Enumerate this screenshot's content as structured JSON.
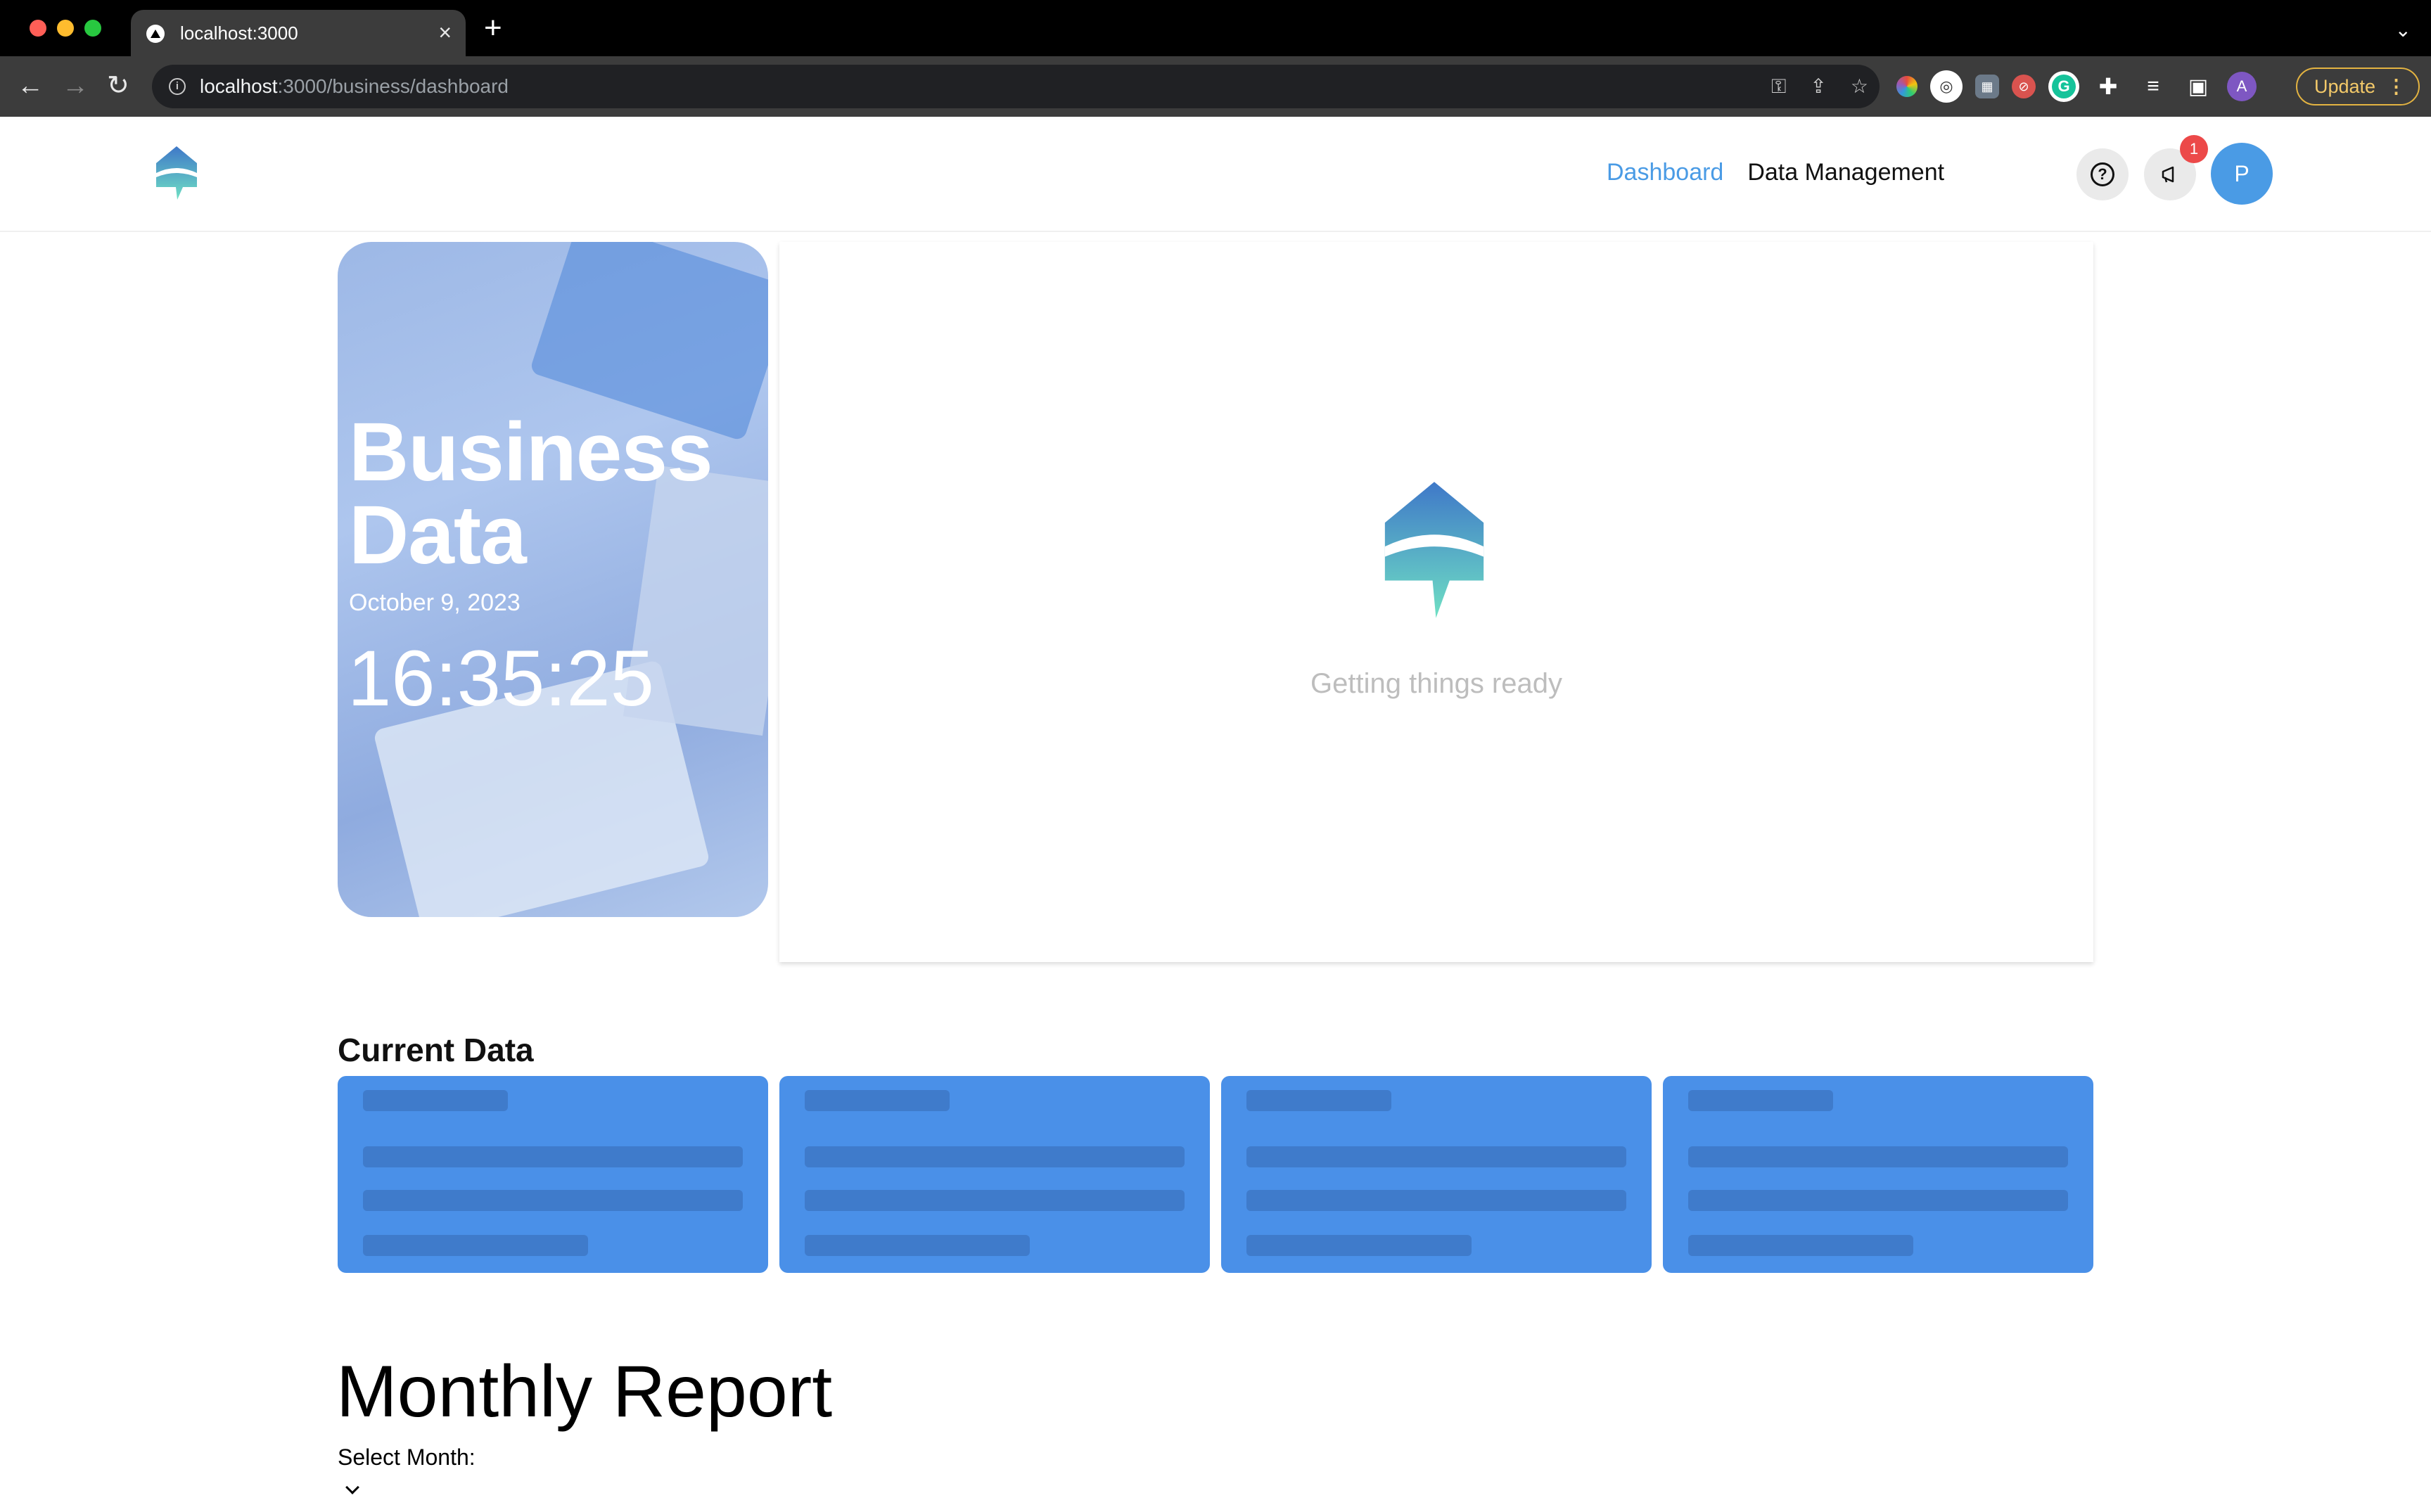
{
  "browser": {
    "tab_title": "localhost:3000",
    "url_host": "localhost",
    "url_path": ":3000/business/dashboard",
    "update_label": "Update",
    "colors": {
      "frame": "#000000",
      "toolbar": "#3c3c3c",
      "update_border": "#e3b341"
    }
  },
  "header": {
    "nav": [
      {
        "label": "Dashboard",
        "active": true
      },
      {
        "label": "Data Management",
        "active": false
      }
    ],
    "notification_count": "1",
    "avatar_initial": "P",
    "colors": {
      "accent": "#4a9be5",
      "badge": "#ec4949"
    }
  },
  "hero": {
    "title_line1": "Business",
    "title_line2": "Data",
    "date": "October 9, 2023",
    "time": "16:35:25"
  },
  "loading": {
    "message": "Getting things ready"
  },
  "current_data": {
    "title": "Current Data",
    "card_color": "#4a90e8",
    "cards": [
      "loading",
      "loading",
      "loading",
      "loading"
    ]
  },
  "report": {
    "title": "Monthly Report",
    "select_label": "Select Month:",
    "selected_value": ""
  }
}
